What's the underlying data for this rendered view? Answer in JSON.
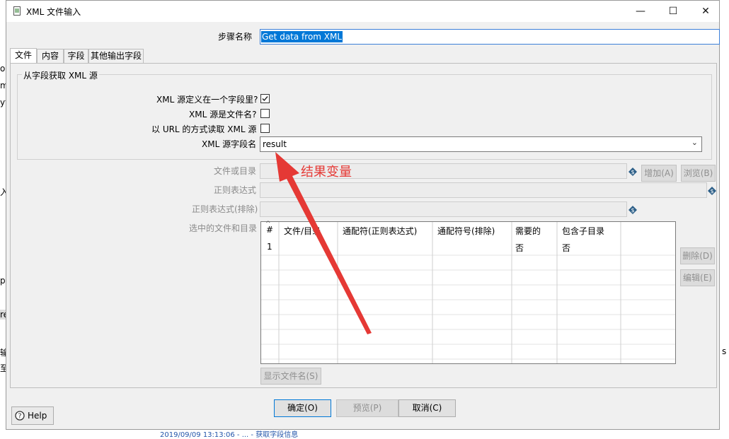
{
  "window": {
    "title": "XML 文件输入",
    "minimize": "—",
    "maximize": "☐",
    "close": "✕"
  },
  "background_fragments": [
    "ou",
    "m",
    "yt",
    "入",
    "p",
    "re",
    "输",
    "至",
    "s",
    "2019/09/09 13:13:06 - ... - 获取字段信息"
  ],
  "step_name": {
    "label": "步骤名称",
    "value": "Get data from XML"
  },
  "tabs": [
    "文件",
    "内容",
    "字段",
    "其他输出字段"
  ],
  "group": {
    "title": "从字段获取 XML 源"
  },
  "options": {
    "xml_in_field_label": "XML 源定义在一个字段里?",
    "xml_in_field_checked": true,
    "xml_is_filename_label": "XML 源是文件名?",
    "xml_is_filename_checked": false,
    "read_as_url_label": "以 URL 的方式读取 XML 源",
    "read_as_url_checked": false,
    "field_name_label": "XML 源字段名",
    "field_name_value": "result"
  },
  "annotation": {
    "text": "结果变量",
    "color": "#e53935"
  },
  "file_section": {
    "file_or_dir_label": "文件或目录",
    "add_button": "增加(A)",
    "browse_button": "浏览(B)",
    "regex_label": "正则表达式",
    "regex_exclude_label": "正则表达式(排除)",
    "selected_label": "选中的文件和目录",
    "delete_button": "删除(D)",
    "edit_button": "编辑(E)",
    "show_filenames_button": "显示文件名(S)"
  },
  "table": {
    "columns": [
      "#",
      "文件/目录",
      "通配符(正则表达式)",
      "通配符号(排除)",
      "需要的",
      "包含子目录"
    ],
    "rows": [
      {
        "num": "1",
        "file": "",
        "wildcard": "",
        "exclude": "",
        "required": "否",
        "subdirs": "否"
      }
    ]
  },
  "footer": {
    "help": "Help",
    "ok": "确定(O)",
    "preview": "预览(P)",
    "cancel": "取消(C)"
  }
}
